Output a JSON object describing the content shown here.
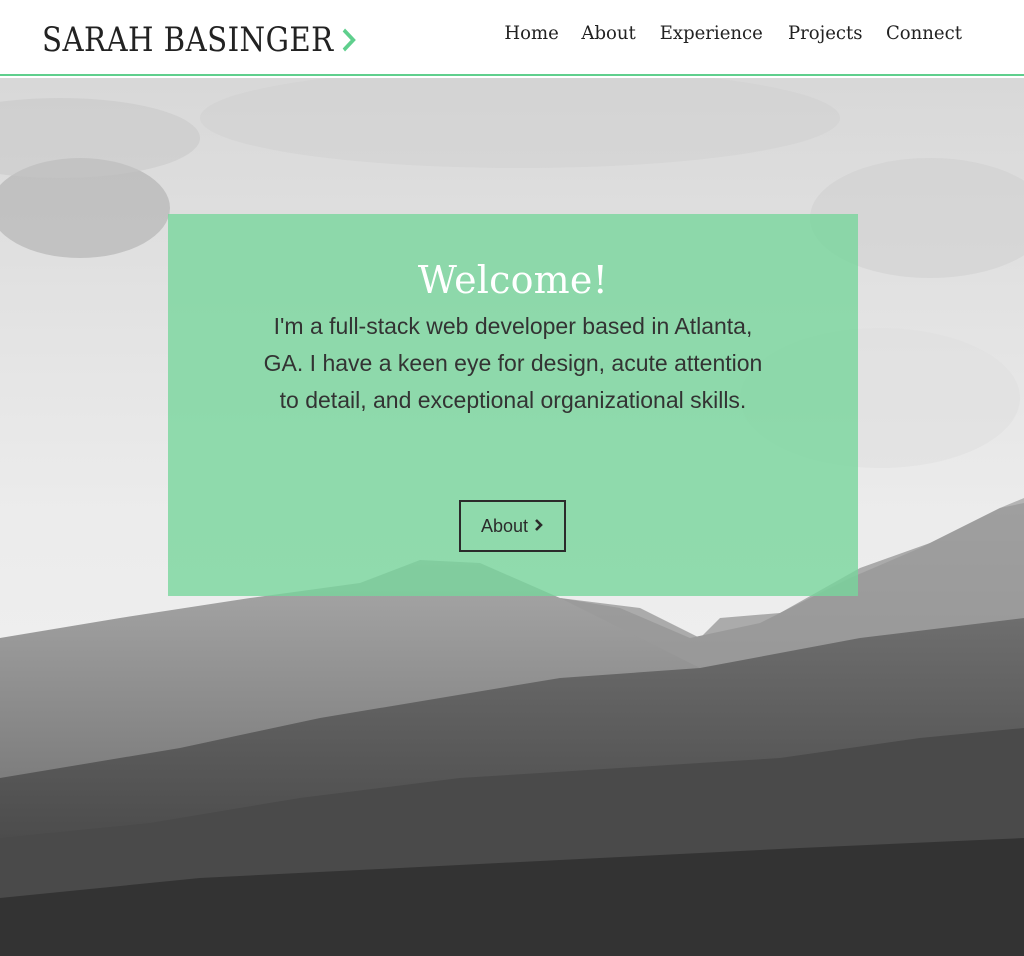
{
  "header": {
    "brand": "SARAH BASINGER",
    "brand_icon": "chevron-right-icon",
    "accent_color": "#5fcf8d",
    "nav": [
      {
        "label": "Home"
      },
      {
        "label": "About"
      },
      {
        "label": "Experience"
      },
      {
        "label": "Projects"
      },
      {
        "label": "Connect"
      }
    ]
  },
  "hero": {
    "background": "black-and-white mountain landscape",
    "panel_color": "#78d69c",
    "title": "Welcome!",
    "text": "I'm a full-stack web developer based in Atlanta, GA. I have a keen eye for design, acute attention to detail, and exceptional organizational skills.",
    "button_label": "About",
    "button_icon": "chevron-right-icon"
  }
}
